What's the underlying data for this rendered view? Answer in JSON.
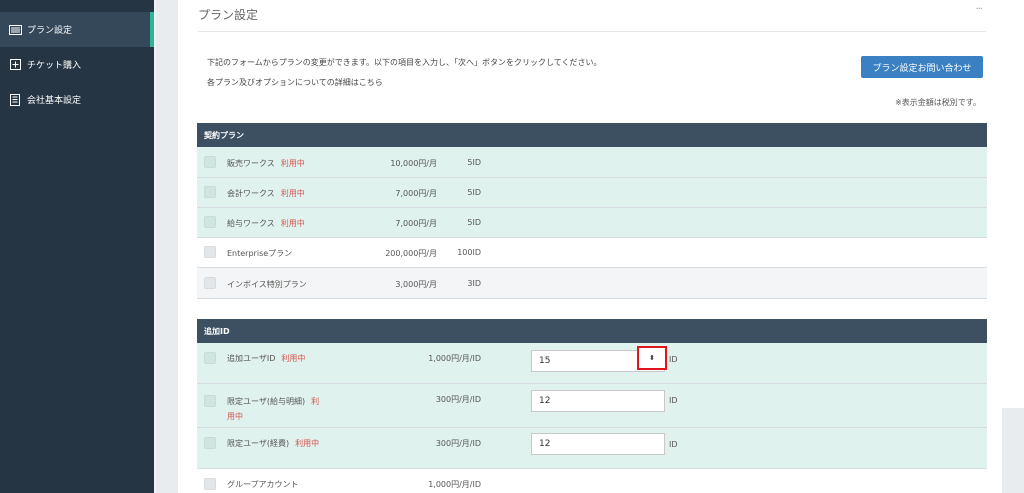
{
  "sidebar": {
    "items": [
      {
        "label": "プラン設定",
        "icon": "plan-list-icon",
        "active": true
      },
      {
        "label": "チケット購入",
        "icon": "plus-box-icon",
        "active": false
      },
      {
        "label": "会社基本設定",
        "icon": "document-icon",
        "active": false
      }
    ]
  },
  "header": {
    "title": "プラン設定",
    "menu_glyph": "···"
  },
  "intro": {
    "line1": "下記のフォームからプランの変更ができます。以下の項目を入力し、「次へ」ボタンをクリックしてください。",
    "line2": "各プラン及びオプションについての詳細はこちら",
    "contact_button": "プラン設定お問い合わせ",
    "tax_note": "※表示金額は税別です。"
  },
  "contract_plan": {
    "heading": "契約プラン",
    "rows": [
      {
        "name": "販売ワークス",
        "status": "利用中",
        "price": "10,000円/月",
        "ids": "5ID"
      },
      {
        "name": "会計ワークス",
        "status": "利用中",
        "price": "7,000円/月",
        "ids": "5ID"
      },
      {
        "name": "給与ワークス",
        "status": "利用中",
        "price": "7,000円/月",
        "ids": "5ID"
      },
      {
        "name": "Enterpriseプラン",
        "status": "",
        "price": "200,000円/月",
        "ids": "100ID"
      },
      {
        "name": "インボイス特別プラン",
        "status": "",
        "price": "3,000円/月",
        "ids": "3ID"
      }
    ]
  },
  "additional_id": {
    "heading": "追加ID",
    "unit": "ID",
    "spin_glyph": "⬍",
    "rows": [
      {
        "name": "追加ユーザID",
        "status": "利用中",
        "price": "1,000円/月/ID",
        "value": "15"
      },
      {
        "name": "限定ユーザ(給与明細)",
        "status": "利",
        "status2": "用中",
        "price": "300円/月/ID",
        "value": "12"
      },
      {
        "name": "限定ユーザ(経費)",
        "status": "利用中",
        "price": "300円/月/ID",
        "value": "12"
      },
      {
        "name": "グループアカウント",
        "status": "",
        "price": "1,000円/月/ID",
        "value": ""
      }
    ]
  },
  "colors": {
    "sidebar_bg": "#253544",
    "accent": "#2fb49a",
    "section_head": "#3c5062",
    "button": "#3a80c3",
    "status": "#d9534f",
    "highlight": "#e0161c"
  }
}
